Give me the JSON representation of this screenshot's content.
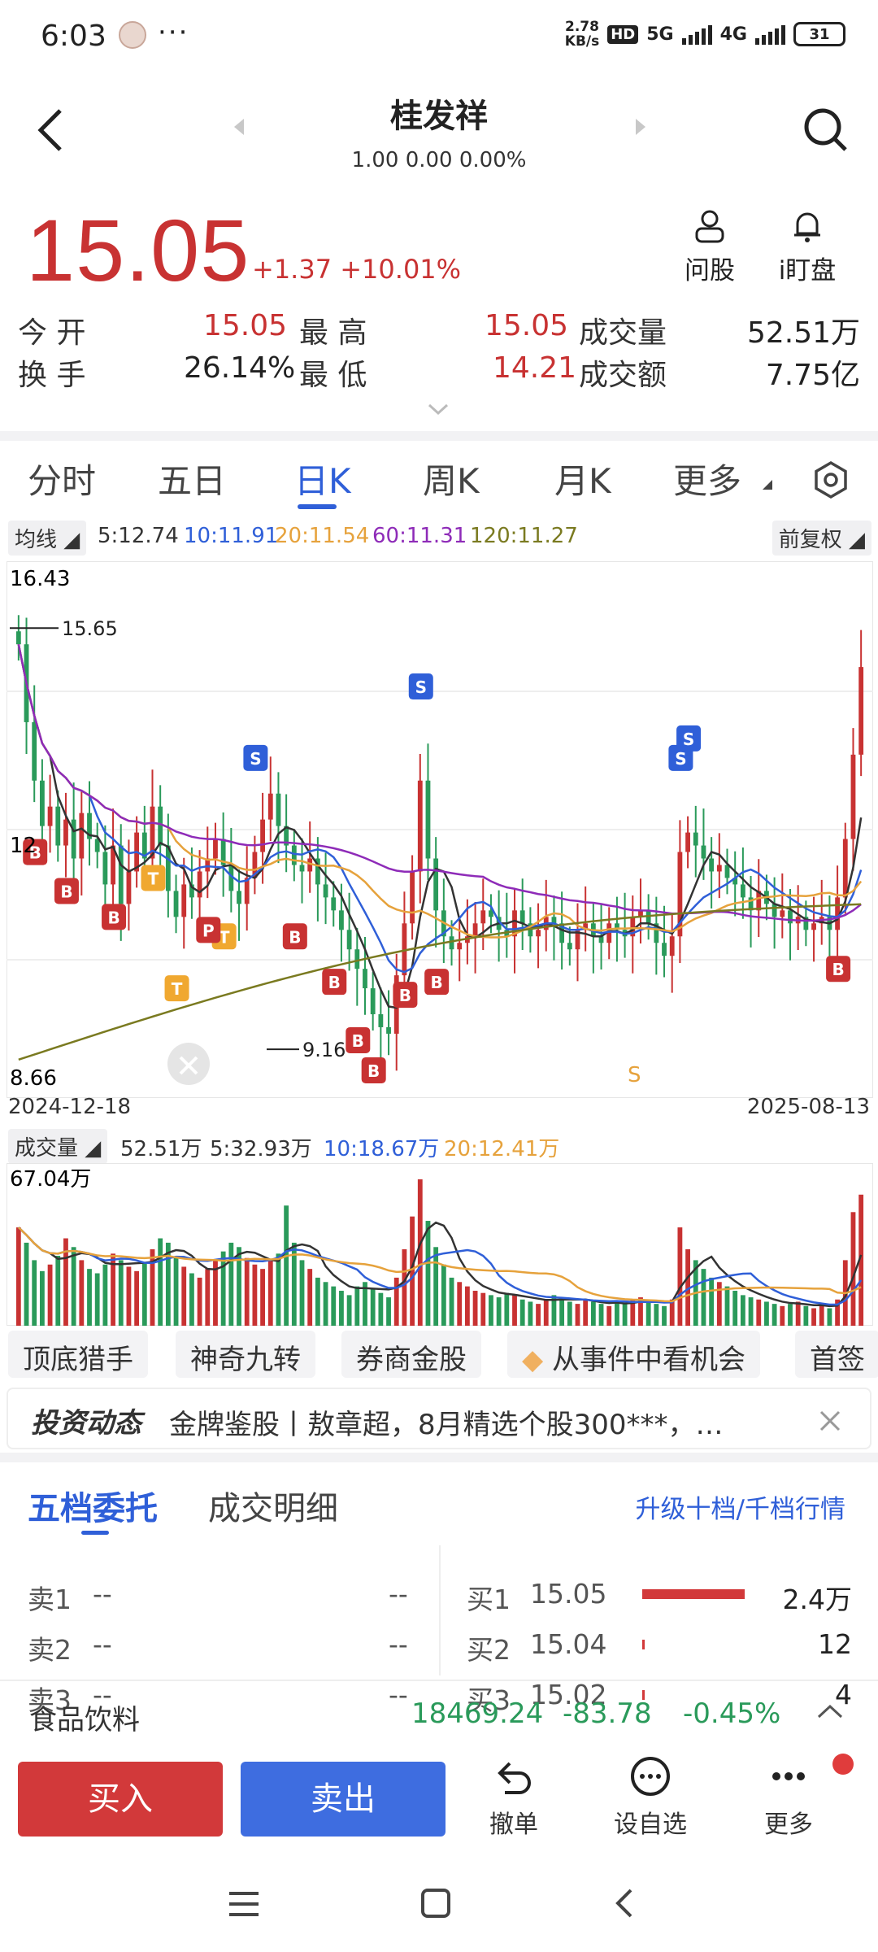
{
  "status_bar": {
    "time": "6:03",
    "net_speed_top": "2.78",
    "net_speed_bottom": "KB/s",
    "hd": "HD",
    "sig1": "5G",
    "sig2": "4G",
    "battery": "31"
  },
  "header": {
    "title": "桂发祥",
    "subtitle": "1.00 0.00 0.00%"
  },
  "quote": {
    "price": "15.05",
    "change": "+1.37 +10.01%"
  },
  "actions": {
    "ask": "问股",
    "watch": "i盯盘"
  },
  "stats": {
    "open_label": "今  开",
    "open": "15.05",
    "high_label": "最  高",
    "high": "15.05",
    "vol_label": "成交量",
    "vol": "52.51万",
    "turn_label": "换  手",
    "turn": "26.14%",
    "low_label": "最  低",
    "low": "14.21",
    "amt_label": "成交额",
    "amt": "7.75亿"
  },
  "tabs": [
    "分时",
    "五日",
    "日K",
    "周K",
    "月K",
    "更多"
  ],
  "ma": {
    "label": "均线",
    "ma5": "5:12.74",
    "ma10": "10:11.91",
    "ma20": "20:11.54",
    "ma60": "60:11.31",
    "ma120": "120:11.27",
    "adj": "前复权"
  },
  "colors": {
    "up": "#c83232",
    "down": "#2a9a5a",
    "accent": "#2f5fd8",
    "ma5": "#333333",
    "ma10": "#2f5fd8",
    "ma20": "#e6a23c",
    "ma60": "#8e2bb8",
    "ma120": "#7a7a20"
  },
  "chart_data": [
    {
      "type": "candlestick",
      "y_top_label": "16.43",
      "y_mid_label": "12",
      "y_bottom_label": "8.66",
      "ylim": [
        8.66,
        16.43
      ],
      "x_start": "2024-12-18",
      "x_end": "2025-08-13",
      "annotations": [
        {
          "text": "15.65",
          "value": 15.65
        },
        {
          "text": "9.16",
          "value": 9.16
        },
        {
          "text": "S",
          "value": null
        }
      ],
      "signals": [
        "B",
        "S",
        "T",
        "P"
      ],
      "close": [
        15.4,
        14.2,
        13.3,
        12.6,
        12.9,
        12.3,
        12.7,
        12.1,
        12.8,
        12.4,
        12.2,
        11.7,
        12.3,
        11.4,
        11.9,
        12.5,
        12.1,
        12.9,
        12.3,
        11.6,
        11.2,
        11.7,
        11.5,
        11.9,
        12.1,
        12.4,
        12.0,
        11.6,
        11.4,
        11.8,
        12.2,
        12.7,
        13.1,
        12.6,
        12.3,
        12.0,
        11.9,
        12.1,
        11.7,
        11.5,
        11.3,
        11.0,
        10.7,
        10.4,
        10.1,
        9.7,
        9.5,
        9.4,
        10.3,
        11.1,
        11.9,
        13.3,
        12.1,
        11.3,
        10.9,
        10.7,
        10.8,
        10.9,
        11.1,
        11.3,
        11.2,
        11.0,
        10.9,
        11.3,
        11.1,
        10.9,
        11.0,
        11.2,
        11.1,
        10.8,
        10.7,
        11.0,
        11.1,
        10.9,
        10.8,
        11.1,
        11.0,
        10.9,
        11.2,
        11.3,
        11.1,
        10.8,
        10.6,
        10.9,
        12.2,
        12.5,
        12.3,
        12.1,
        11.9,
        12.0,
        11.8,
        11.7,
        11.5,
        11.3,
        11.6,
        11.4,
        11.2,
        11.3,
        11.1,
        11.2,
        11.0,
        11.1,
        11.2,
        11.0,
        11.5,
        12.4,
        13.7,
        15.05
      ]
    },
    {
      "type": "bar",
      "title": "成交量",
      "vol": "52.51万",
      "ma5": "5:32.93万",
      "ma10": "10:18.67万",
      "ma20": "20:12.41万",
      "y_top_label": "67.04万",
      "values": [
        45,
        38,
        30,
        25,
        28,
        32,
        40,
        36,
        30,
        26,
        24,
        28,
        33,
        30,
        27,
        25,
        29,
        35,
        40,
        38,
        31,
        27,
        24,
        22,
        26,
        30,
        34,
        38,
        36,
        31,
        28,
        26,
        30,
        33,
        55,
        38,
        30,
        26,
        22,
        20,
        18,
        16,
        14,
        18,
        20,
        17,
        15,
        13,
        22,
        35,
        50,
        67,
        48,
        36,
        28,
        22,
        20,
        18,
        16,
        15,
        14,
        13,
        15,
        14,
        12,
        11,
        10,
        12,
        14,
        13,
        11,
        10,
        12,
        11,
        10,
        9,
        11,
        10,
        12,
        13,
        11,
        10,
        9,
        12,
        45,
        35,
        30,
        26,
        22,
        20,
        18,
        16,
        14,
        13,
        12,
        11,
        10,
        9,
        10,
        11,
        9,
        8,
        9,
        8,
        12,
        30,
        52,
        60
      ]
    }
  ],
  "chips": [
    "顶底猎手",
    "神奇九转",
    "券商金股",
    "从事件中看机会",
    "首签"
  ],
  "news": {
    "tag": "投资动态",
    "text": "金牌鉴股丨敖章超，8月精选个股300***，…"
  },
  "orderbook": {
    "tab_active": "五档委托",
    "tab_other": "成交明细",
    "upgrade": "升级十档/千档行情",
    "asks": [
      {
        "label": "卖1",
        "price": "--",
        "vol": "--"
      },
      {
        "label": "卖2",
        "price": "--",
        "vol": "--"
      },
      {
        "label": "卖3",
        "price": "--",
        "vol": "--"
      }
    ],
    "bids": [
      {
        "label": "买1",
        "price": "15.05",
        "vol": "2.4万",
        "fill": 1.0
      },
      {
        "label": "买2",
        "price": "15.04",
        "vol": "12",
        "fill": 0.01
      },
      {
        "label": "买3",
        "price": "15.02",
        "vol": "4",
        "fill": 0.01
      }
    ]
  },
  "sector": {
    "name": "食品饮料",
    "index": "18469.24",
    "chg": "-83.78",
    "pct": "-0.45%"
  },
  "bottom": {
    "buy": "买入",
    "sell": "卖出",
    "cancel": "撤单",
    "watchlist": "设自选",
    "more": "更多"
  }
}
